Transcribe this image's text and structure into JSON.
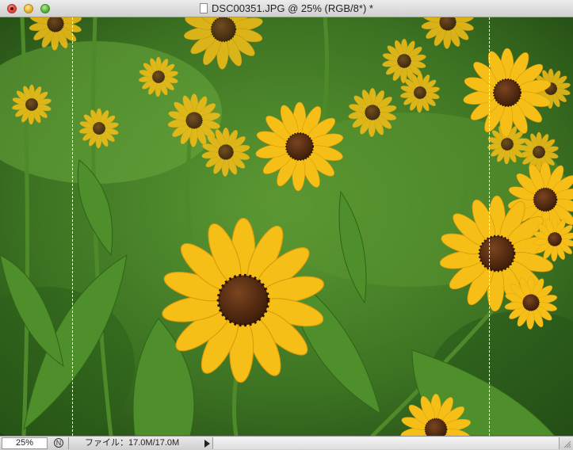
{
  "window": {
    "title": "DSC00351.JPG @ 25% (RGB/8*) *",
    "buttons": {
      "close": "close-button",
      "minimize": "minimize-button",
      "zoom": "zoom-button"
    }
  },
  "status": {
    "zoom_value": "25%",
    "info_text": "ファイル：17.0M/17.0M",
    "nav_icon": "navigator-icon"
  },
  "colors": {
    "titlebar_top": "#ececec",
    "titlebar_bottom": "#d0d0d0",
    "petal_yellow": "#f7c21b",
    "center_brown": "#5a2e12",
    "foliage_green": "#3f7a22"
  }
}
